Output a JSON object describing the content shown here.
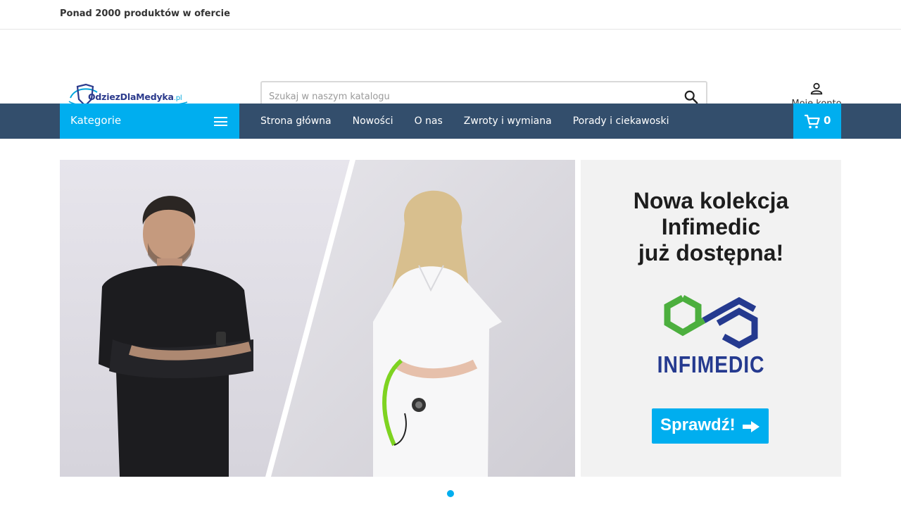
{
  "topbar": {
    "tagline": "Ponad 2000 produktów w ofercie"
  },
  "header": {
    "logo": {
      "name": "OdziezDlaMedyka",
      "suffix": ".pl"
    },
    "search": {
      "placeholder": "Szukaj w naszym katalogu",
      "value": ""
    },
    "account": {
      "label": "Moje konto",
      "icon": "person-icon"
    }
  },
  "nav": {
    "categories_label": "Kategorie",
    "links": [
      "Strona główna",
      "Nowości",
      "O nas",
      "Zwroty i wymiana",
      "Porady i ciekawoski"
    ],
    "cart": {
      "count": "0",
      "icon": "cart-icon"
    }
  },
  "banner": {
    "promo_title": "Nowa kolekcja\nInfimedic\njuż dostępna!",
    "brand": "INFIMEDIC",
    "cta_label": "Sprawdź!",
    "slide_count": 1,
    "active_slide": 1
  },
  "colors": {
    "accent": "#00aeef",
    "nav_bg": "#334e6c",
    "brand_blue": "#253a8f",
    "brand_green": "#4caf3e"
  }
}
